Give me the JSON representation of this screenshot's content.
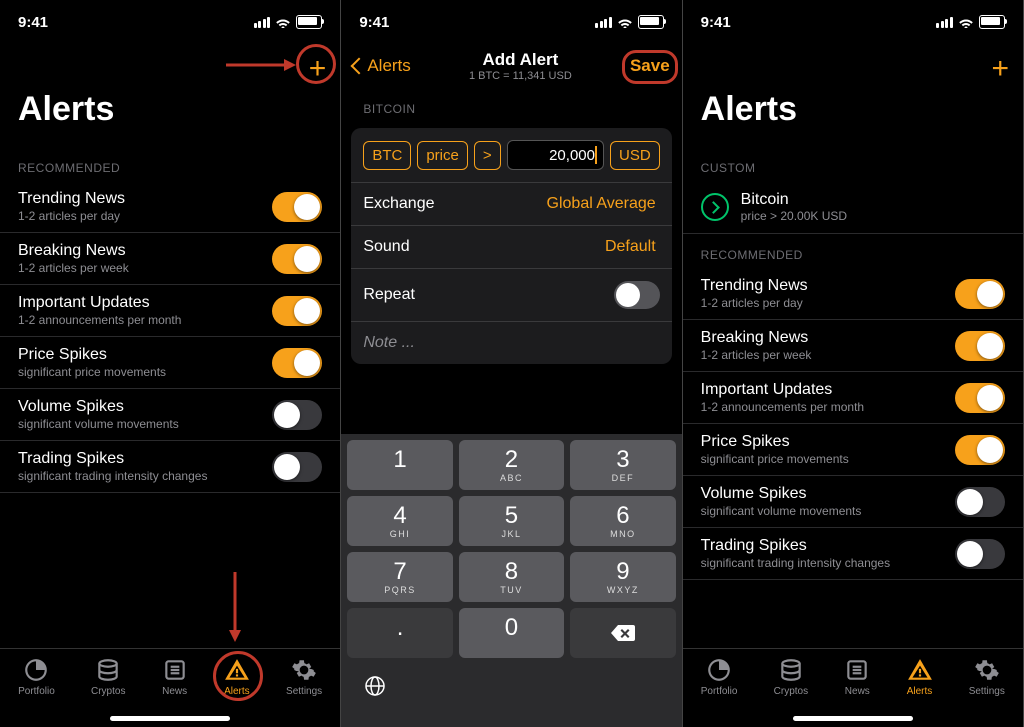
{
  "status_time": "9:41",
  "screen1": {
    "title": "Alerts",
    "sections": [
      {
        "header": "RECOMMENDED",
        "items": [
          {
            "title": "Trending News",
            "sub": "1-2 articles per day",
            "on": true
          },
          {
            "title": "Breaking News",
            "sub": "1-2 articles per week",
            "on": true
          },
          {
            "title": "Important Updates",
            "sub": "1-2 announcements per month",
            "on": true
          },
          {
            "title": "Price Spikes",
            "sub": "significant price movements",
            "on": true
          },
          {
            "title": "Volume Spikes",
            "sub": "significant volume movements",
            "on": false
          },
          {
            "title": "Trading Spikes",
            "sub": "significant trading intensity changes",
            "on": false
          }
        ]
      }
    ]
  },
  "screen2": {
    "back_label": "Alerts",
    "title": "Add Alert",
    "subtitle": "1 BTC = 11,341 USD",
    "save_label": "Save",
    "section_header": "BITCOIN",
    "chips": {
      "asset": "BTC",
      "metric": "price",
      "op": ">",
      "amount": "20,000",
      "unit": "USD"
    },
    "rows": {
      "exchange_label": "Exchange",
      "exchange_value": "Global Average",
      "sound_label": "Sound",
      "sound_value": "Default",
      "repeat_label": "Repeat",
      "note_placeholder": "Note ..."
    },
    "keypad": {
      "keys": [
        [
          "1",
          ""
        ],
        [
          "2",
          "ABC"
        ],
        [
          "3",
          "DEF"
        ],
        [
          "4",
          "GHI"
        ],
        [
          "5",
          "JKL"
        ],
        [
          "6",
          "MNO"
        ],
        [
          "7",
          "PQRS"
        ],
        [
          "8",
          "TUV"
        ],
        [
          "9",
          "WXYZ"
        ],
        [
          ".",
          ""
        ],
        [
          "0",
          ""
        ],
        [
          "⌫",
          ""
        ]
      ]
    }
  },
  "screen3": {
    "title": "Alerts",
    "custom_header": "CUSTOM",
    "custom_item": {
      "title": "Bitcoin",
      "sub": "price > 20.00K USD"
    },
    "rec_header": "RECOMMENDED",
    "items": [
      {
        "title": "Trending News",
        "sub": "1-2 articles per day",
        "on": true
      },
      {
        "title": "Breaking News",
        "sub": "1-2 articles per week",
        "on": true
      },
      {
        "title": "Important Updates",
        "sub": "1-2 announcements per month",
        "on": true
      },
      {
        "title": "Price Spikes",
        "sub": "significant price movements",
        "on": true
      },
      {
        "title": "Volume Spikes",
        "sub": "significant volume movements",
        "on": false
      },
      {
        "title": "Trading Spikes",
        "sub": "significant trading intensity changes",
        "on": false
      }
    ]
  },
  "tabs": [
    {
      "label": "Portfolio"
    },
    {
      "label": "Cryptos"
    },
    {
      "label": "News"
    },
    {
      "label": "Alerts"
    },
    {
      "label": "Settings"
    }
  ]
}
